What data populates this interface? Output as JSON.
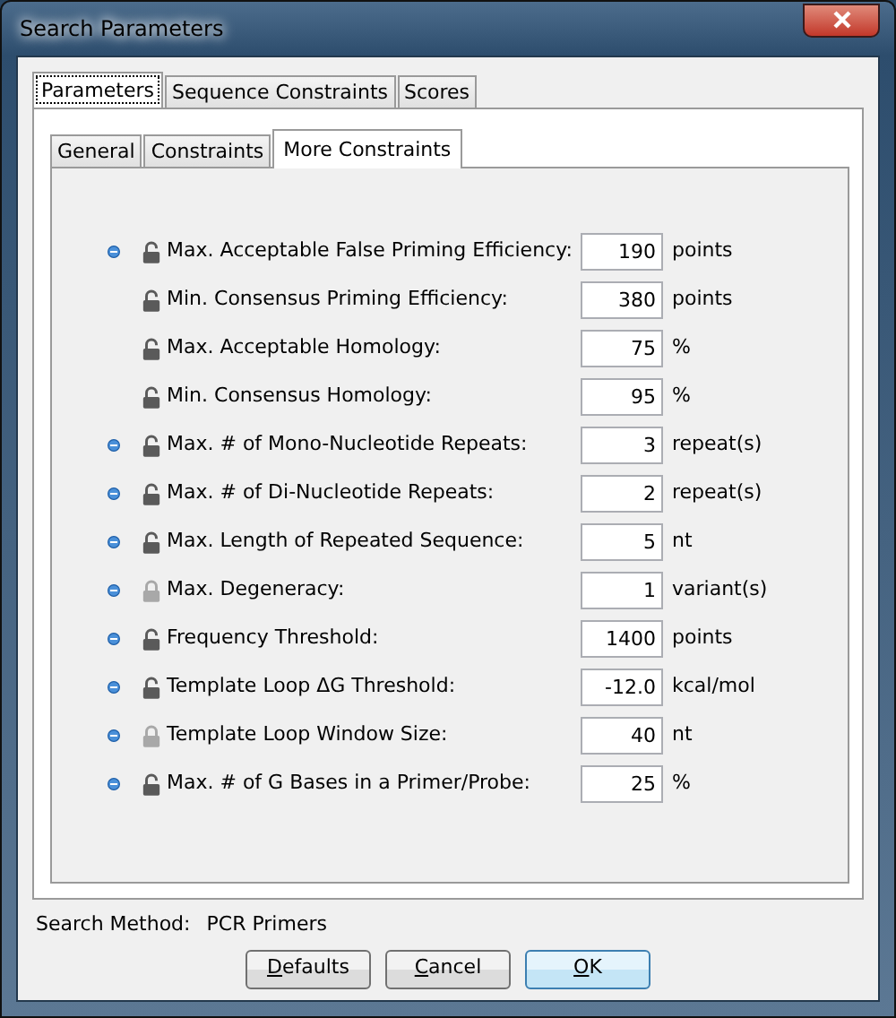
{
  "window": {
    "title": "Search Parameters"
  },
  "tabs": [
    {
      "label": "Parameters",
      "selected": true
    },
    {
      "label": "Sequence Constraints",
      "selected": false
    },
    {
      "label": "Scores",
      "selected": false
    }
  ],
  "subtabs": [
    {
      "label": "General",
      "selected": false
    },
    {
      "label": "Constraints",
      "selected": false
    },
    {
      "label": "More Constraints",
      "selected": true
    }
  ],
  "parameters": [
    {
      "marked": true,
      "lock_enabled": true,
      "label": "Max. Acceptable False Priming Efficiency:",
      "value": "190",
      "unit": "points"
    },
    {
      "marked": false,
      "lock_enabled": true,
      "label": "Min. Consensus Priming Efficiency:",
      "value": "380",
      "unit": "points"
    },
    {
      "marked": false,
      "lock_enabled": true,
      "label": "Max. Acceptable Homology:",
      "value": "75",
      "unit": "%"
    },
    {
      "marked": false,
      "lock_enabled": true,
      "label": "Min. Consensus Homology:",
      "value": "95",
      "unit": "%"
    },
    {
      "marked": true,
      "lock_enabled": true,
      "label": "Max. # of Mono-Nucleotide Repeats:",
      "value": "3",
      "unit": "repeat(s)"
    },
    {
      "marked": true,
      "lock_enabled": true,
      "label": "Max. # of Di-Nucleotide Repeats:",
      "value": "2",
      "unit": "repeat(s)"
    },
    {
      "marked": true,
      "lock_enabled": true,
      "label": "Max. Length of Repeated Sequence:",
      "value": "5",
      "unit": "nt"
    },
    {
      "marked": true,
      "lock_enabled": false,
      "label": "Max. Degeneracy:",
      "value": "1",
      "unit": "variant(s)"
    },
    {
      "marked": true,
      "lock_enabled": true,
      "label": "Frequency Threshold:",
      "value": "1400",
      "unit": "points"
    },
    {
      "marked": true,
      "lock_enabled": true,
      "label": "Template Loop ΔG Threshold:",
      "value": "-12.0",
      "unit": "kcal/mol"
    },
    {
      "marked": true,
      "lock_enabled": false,
      "label": "Template Loop Window Size:",
      "value": "40",
      "unit": "nt"
    },
    {
      "marked": true,
      "lock_enabled": true,
      "label": "Max. # of G Bases in a Primer/Probe:",
      "value": "25",
      "unit": "%"
    }
  ],
  "search_method": {
    "label": "Search Method:",
    "value": "PCR Primers"
  },
  "buttons": [
    {
      "mnemonic": "D",
      "rest": "efaults",
      "default": false
    },
    {
      "mnemonic": "C",
      "rest": "ancel",
      "default": false
    },
    {
      "mnemonic": "O",
      "rest": "K",
      "default": true
    }
  ]
}
